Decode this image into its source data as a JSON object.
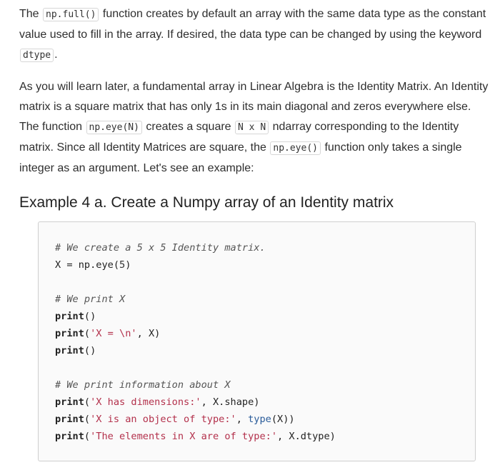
{
  "para1": {
    "t1": "The ",
    "c1": "np.full()",
    "t2": " function creates by default an array with the same data type as the constant value used to fill in the array. If desired, the data type can be changed by using the keyword ",
    "c2": "dtype",
    "t3": "."
  },
  "para2": {
    "t1": "As you will learn later, a fundamental array in Linear Algebra is the Identity Matrix. An Identity matrix is a square matrix that has only 1s in its main diagonal and zeros everywhere else. The function ",
    "c1": "np.eye(N)",
    "t2": " creates a square ",
    "c2": "N x N",
    "t3": " ndarray corresponding to the Identity matrix. Since all Identity Matrices are square, the ",
    "c3": "np.eye()",
    "t4": " function only takes a single integer as an argument. Let's see an example:"
  },
  "heading": "Example 4 a. Create a Numpy array of an Identity matrix",
  "code": {
    "l1": "# We create a 5 x 5 Identity matrix.",
    "l2a": "X = np.eye(",
    "l2b": "5",
    "l2c": ")",
    "l3": "# We print X",
    "l4a": "print",
    "l4b": "()",
    "l5a": "print",
    "l5b": "(",
    "l5c": "'X = \\n'",
    "l5d": ", X)",
    "l6a": "print",
    "l6b": "()",
    "l7": "# We print information about X",
    "l8a": "print",
    "l8b": "(",
    "l8c": "'X has dimensions:'",
    "l8d": ", X.shape)",
    "l9a": "print",
    "l9b": "(",
    "l9c": "'X is an object of type:'",
    "l9d": ", ",
    "l9e": "type",
    "l9f": "(X))",
    "l10a": "print",
    "l10b": "(",
    "l10c": "'The elements in X are of type:'",
    "l10d": ", X.dtype)"
  }
}
